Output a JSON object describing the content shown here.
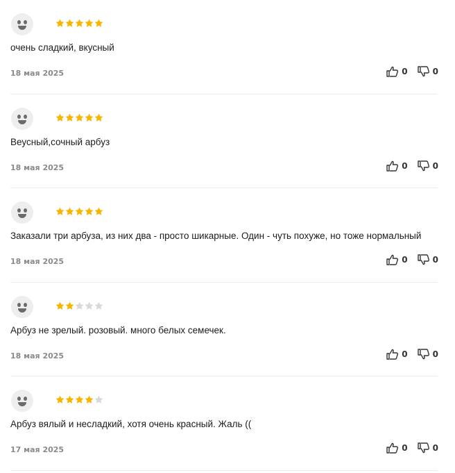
{
  "colors": {
    "star_filled": "#f7b500",
    "star_empty": "#d9d9d9",
    "date": "#8a8a8a",
    "divider": "#ececec"
  },
  "reviews": [
    {
      "rating": 5,
      "text": "очень сладкий, вкусный",
      "date": "18 мая 2025",
      "likes": "0",
      "dislikes": "0"
    },
    {
      "rating": 5,
      "text": "Веусный,сочный арбуз",
      "date": "18 мая 2025",
      "likes": "0",
      "dislikes": "0"
    },
    {
      "rating": 5,
      "text": "Заказали три арбуза, из них два - просто шикарные. Один - чуть похуже, но тоже нормальный",
      "date": "18 мая 2025",
      "likes": "0",
      "dislikes": "0"
    },
    {
      "rating": 2,
      "text": "Арбуз не зрелый. розовый. много белых семечек.",
      "date": "18 мая 2025",
      "likes": "0",
      "dislikes": "0"
    },
    {
      "rating": 4,
      "text": "Арбуз вялый и несладкий, хотя очень красный. Жаль ((",
      "date": "17 мая 2025",
      "likes": "0",
      "dislikes": "0"
    }
  ]
}
